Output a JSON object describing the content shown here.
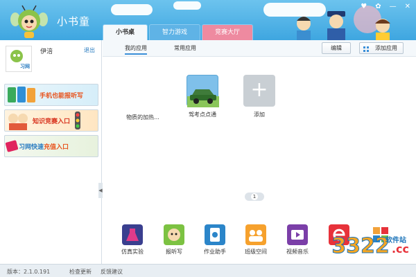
{
  "app": {
    "title": "小书童"
  },
  "window": {
    "skin_icon": "♥",
    "settings_icon": "✿",
    "minimize": "—",
    "close": "✕"
  },
  "tabs": [
    {
      "label": "小书桌"
    },
    {
      "label": "智力游戏"
    },
    {
      "label": "竞赛大厅"
    }
  ],
  "user": {
    "name": "伊涪",
    "logout": "退出",
    "logo_text": "习网"
  },
  "banners": [
    {
      "text": "手机也能报听写"
    },
    {
      "text": "知识竞赛入口"
    },
    {
      "text_a": "习网快速",
      "text_b": "充值入口"
    }
  ],
  "subnav": {
    "my_apps": "我的应用",
    "common_apps": "常用应用",
    "edit": "编辑",
    "add_app": "添加应用"
  },
  "apps": [
    {
      "label": "物质的加热..."
    },
    {
      "label": "驾考点点通"
    },
    {
      "label": "添加",
      "icon": "+"
    }
  ],
  "pager": {
    "current": "1"
  },
  "tools": [
    {
      "label": "仿真实验"
    },
    {
      "label": "报听写"
    },
    {
      "label": "作业助手"
    },
    {
      "label": "班级空间"
    },
    {
      "label": "视频音乐"
    },
    {
      "label": ""
    },
    {
      "label": ""
    }
  ],
  "footer": {
    "version": "版本：2.1.0.191",
    "update": "检查更新",
    "feedback": "反馈建议"
  },
  "watermark": {
    "text": "3322",
    "domain": ".cc",
    "site": "软件站"
  },
  "colors": {
    "header": "#3ea6e0",
    "accent": "#2b7dc1",
    "pink_tab": "#ee8aa0"
  }
}
